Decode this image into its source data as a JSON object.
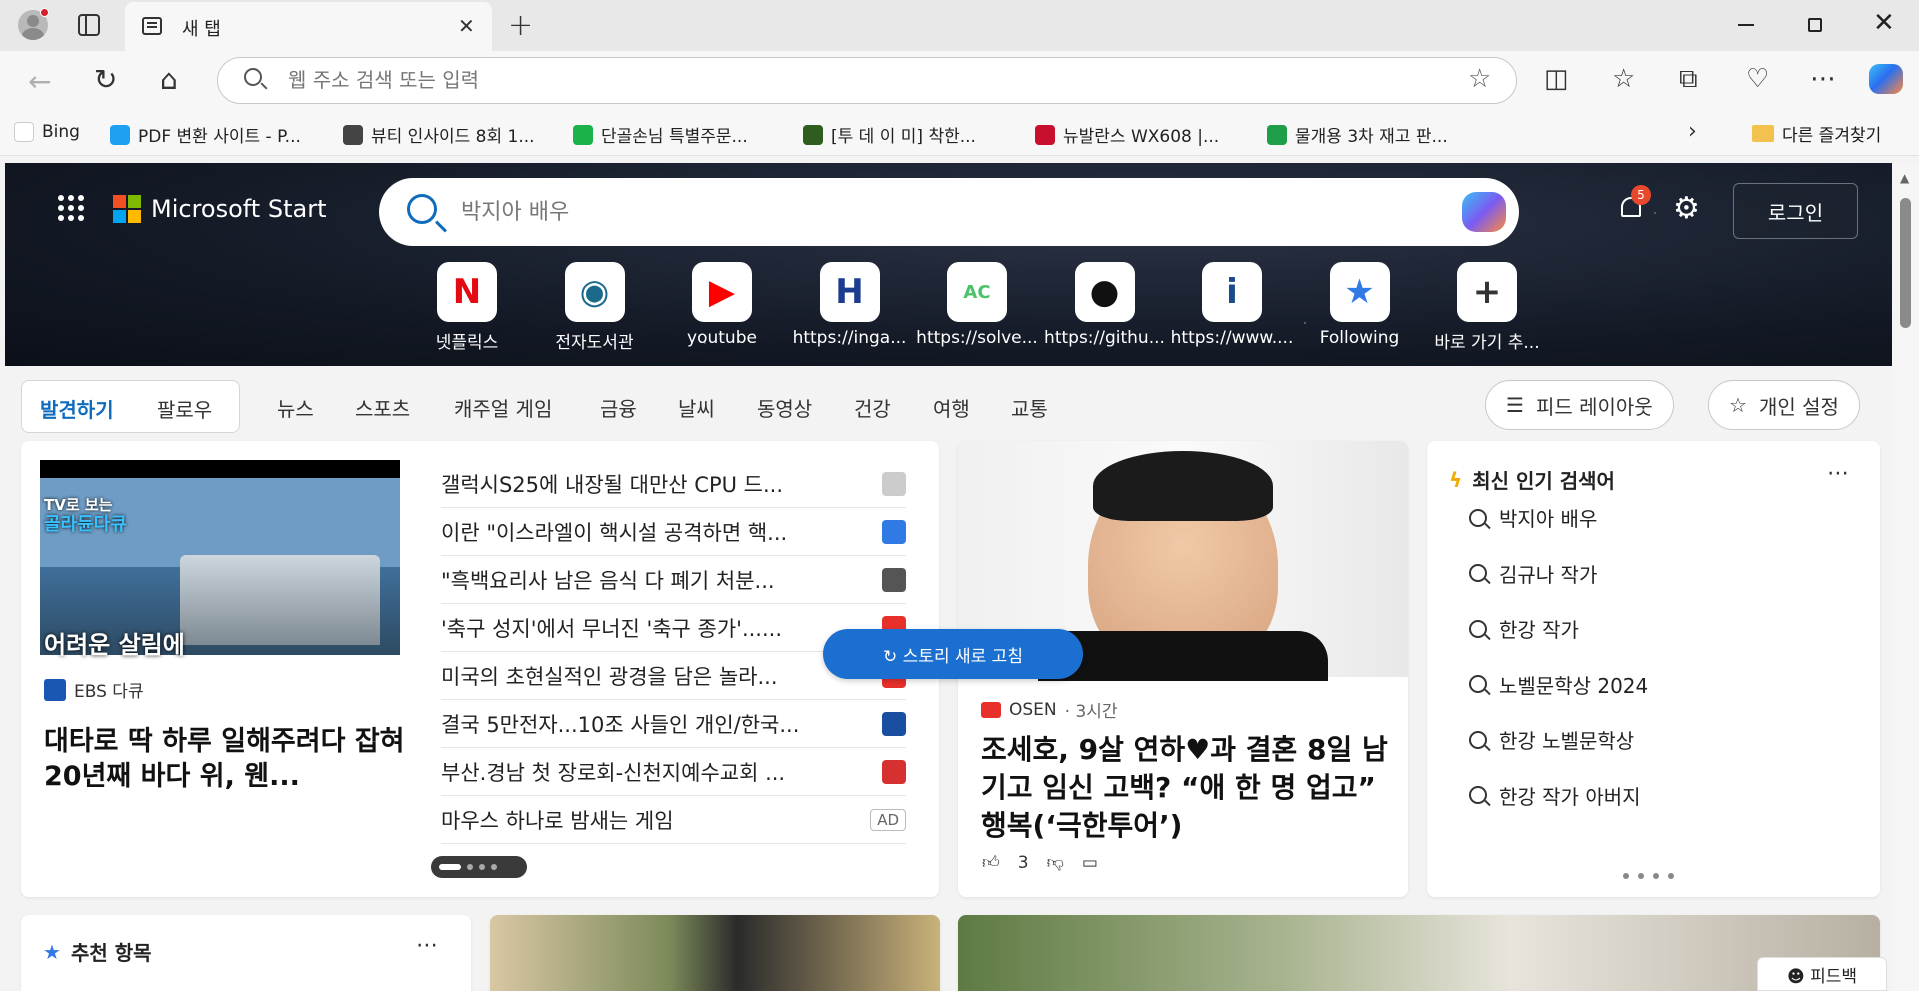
{
  "browser": {
    "tab_title": "새 탭",
    "address_placeholder": "웹 주소 검색 또는 입력",
    "bookmarks": [
      {
        "label": "Bing",
        "color": "#ffffff"
      },
      {
        "label": "PDF 변환 사이트 - P...",
        "color": "#1ea0f1"
      },
      {
        "label": "뷰티 인사이드 8회 1...",
        "color": "#444444"
      },
      {
        "label": "단골손님 특별주문...",
        "color": "#19b34a"
      },
      {
        "label": "[투 데 이 미] 착한...",
        "color": "#2f5d1f"
      },
      {
        "label": "뉴발란스 WX608 |...",
        "color": "#c8102e"
      },
      {
        "label": "물개용 3차 재고 판...",
        "color": "#1f9e4a"
      }
    ],
    "other_favorites": "다른 즐겨찾기"
  },
  "start": {
    "brand": "Microsoft Start",
    "search_placeholder": "박지아 배우",
    "notification_count": "5",
    "login_label": "로그인",
    "quick_links": [
      {
        "label": "넷플릭스",
        "glyph": "N",
        "color": "#e50914"
      },
      {
        "label": "전자도서관",
        "glyph": "◉",
        "color": "#1a6a8c"
      },
      {
        "label": "youtube",
        "glyph": "▶",
        "color": "#ff0000"
      },
      {
        "label": "https://inga...",
        "glyph": "H",
        "color": "#1b3c8f"
      },
      {
        "label": "https://solve...",
        "glyph": "AC",
        "color": "#4cc26a"
      },
      {
        "label": "https://githu...",
        "glyph": "●",
        "color": "#111111"
      },
      {
        "label": "https://www....",
        "glyph": "i",
        "color": "#1b4b8f"
      },
      {
        "label": "Following",
        "glyph": "★",
        "color": "#2f7ae5"
      },
      {
        "label": "바로 가기 추...",
        "glyph": "+",
        "color": "#333333"
      }
    ]
  },
  "nav": {
    "discover": "발견하기",
    "follow": "팔로우",
    "categories": [
      "뉴스",
      "스포츠",
      "캐주얼 게임",
      "금융",
      "날씨",
      "동영상",
      "건강",
      "여행",
      "교통"
    ],
    "feed_layout": "피드 레이아웃",
    "personalize": "개인 설정"
  },
  "feature_card": {
    "thumb_caption_1": "TV로 보는",
    "thumb_caption_2": "골라듄다큐",
    "thumb_caption_3": "어려운 살림에",
    "source": "EBS 다큐",
    "headline": "대타로 딱 하루 일해주려다 잡혀 20년째 바다 위, 웬...",
    "news": [
      {
        "text": "갤럭시S25에 내장될 대만산 CPU 드...",
        "icon_color": "#cccccc",
        "ad": ""
      },
      {
        "text": "이란 \"이스라엘이 핵시설 공격하면 핵...",
        "icon_color": "#2f7ae5",
        "ad": ""
      },
      {
        "text": "\"흑백요리사 남은 음식 다 폐기 처분...",
        "icon_color": "#555555",
        "ad": ""
      },
      {
        "text": "'축구 성지'에서 무너진 '축구 종가'......",
        "icon_color": "#e8302a",
        "ad": ""
      },
      {
        "text": "미국의 초현실적인 광경을 담은 놀라...",
        "icon_color": "#e8302a",
        "ad": ""
      },
      {
        "text": "결국 5만전자...10조 사들인 개인/한국...",
        "icon_color": "#1a4ea0",
        "ad": ""
      },
      {
        "text": "부산.경남 첫 장로회-신천지예수교회 ...",
        "icon_color": "#d63030",
        "ad": ""
      },
      {
        "text": "마우스 하나로 밤새는 게임",
        "icon_color": "",
        "ad": "AD"
      }
    ],
    "refresh_label": "스토리 새로 고침"
  },
  "osen_card": {
    "source": "OSEN",
    "time": "· 3시간",
    "headline": "조세호, 9살 연하♥과 결혼 8일 남기고 임신 고백? “애 한 명 업고” 행복(‘극한투어’)",
    "likes": "3"
  },
  "trending": {
    "title": "최신 인기 검색어",
    "items": [
      "박지아 배우",
      "김규나 작가",
      "한강 작가",
      "노벨문학상 2024",
      "한강 노벨문학상",
      "한강 작가 아버지"
    ]
  },
  "recommended": {
    "title": "추천 항목"
  },
  "feedback_label": "피드백"
}
